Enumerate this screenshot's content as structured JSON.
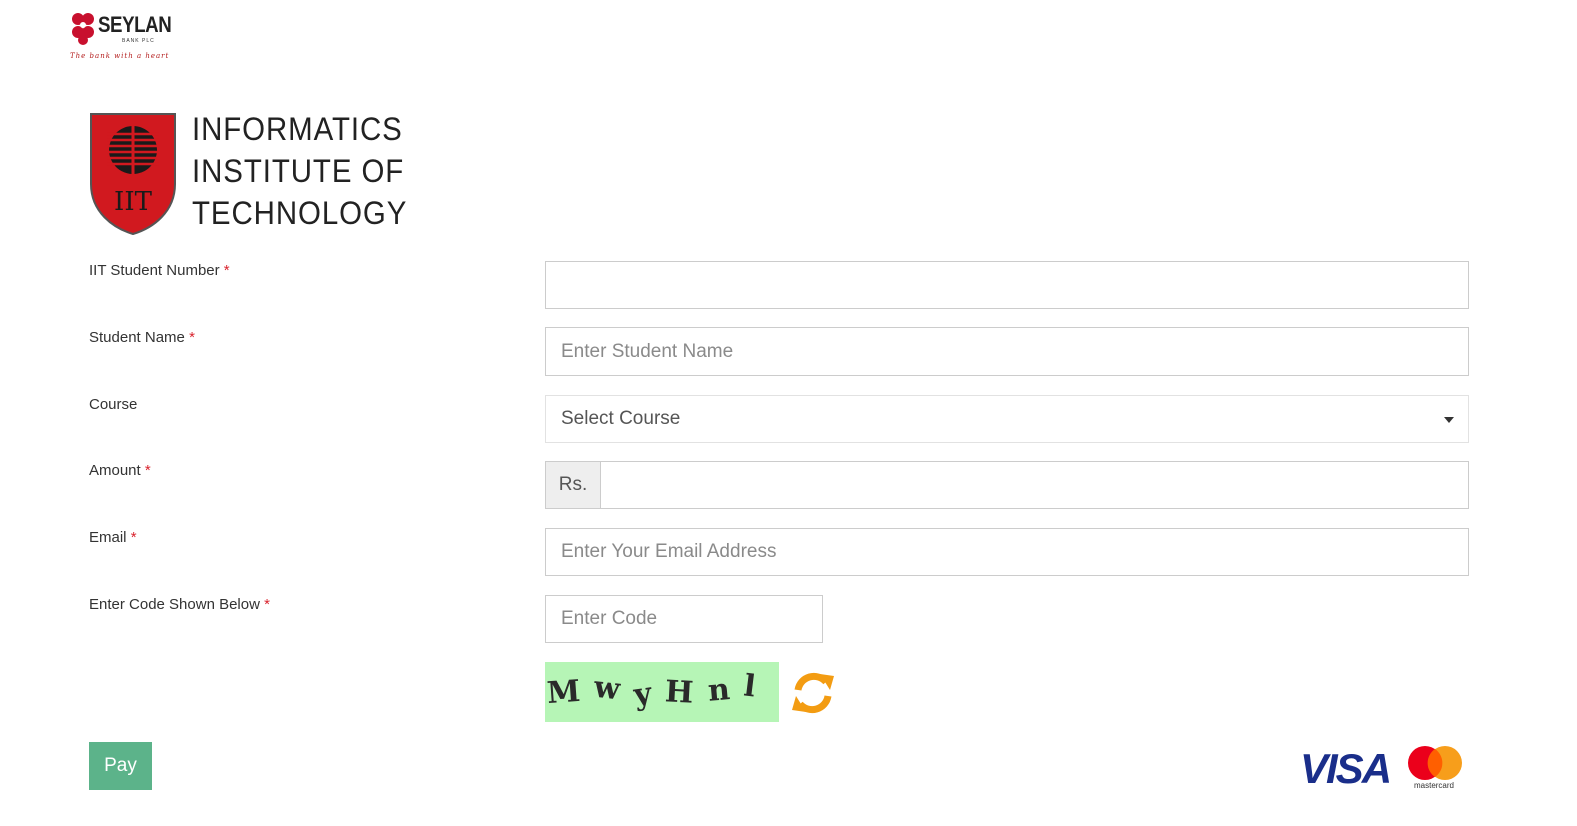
{
  "header": {
    "bank_name": "SEYLAN",
    "bank_sub": "BANK PLC",
    "bank_tagline": "The bank with a heart"
  },
  "institute": {
    "shield_letters": "IIT",
    "title_lines": [
      "INFORMATICS",
      "INSTITUTE OF",
      "TECHNOLOGY"
    ]
  },
  "form": {
    "required_mark": "*",
    "student_number": {
      "label": "IIT Student Number",
      "value": "",
      "placeholder": ""
    },
    "student_name": {
      "label": "Student Name",
      "value": "",
      "placeholder": "Enter Student Name"
    },
    "course": {
      "label": "Course",
      "selected": "Select Course"
    },
    "amount": {
      "label": "Amount",
      "prefix": "Rs.",
      "value": "",
      "placeholder": ""
    },
    "email": {
      "label": "Email",
      "value": "",
      "placeholder": "Enter Your Email Address"
    },
    "code": {
      "label": "Enter Code Shown Below",
      "value": "",
      "placeholder": "Enter Code"
    },
    "captcha_chars": [
      "M",
      "w",
      "y",
      "H",
      "n",
      "l"
    ],
    "pay_label": "Pay"
  },
  "payment_brands": {
    "visa": "VISA",
    "mastercard": "mastercard"
  },
  "colors": {
    "pay_button": "#5cb38a",
    "required": "#d9232d",
    "captcha_bg": "#b6f5b6",
    "refresh_icon": "#f39c12",
    "iit_red": "#d1191f"
  }
}
